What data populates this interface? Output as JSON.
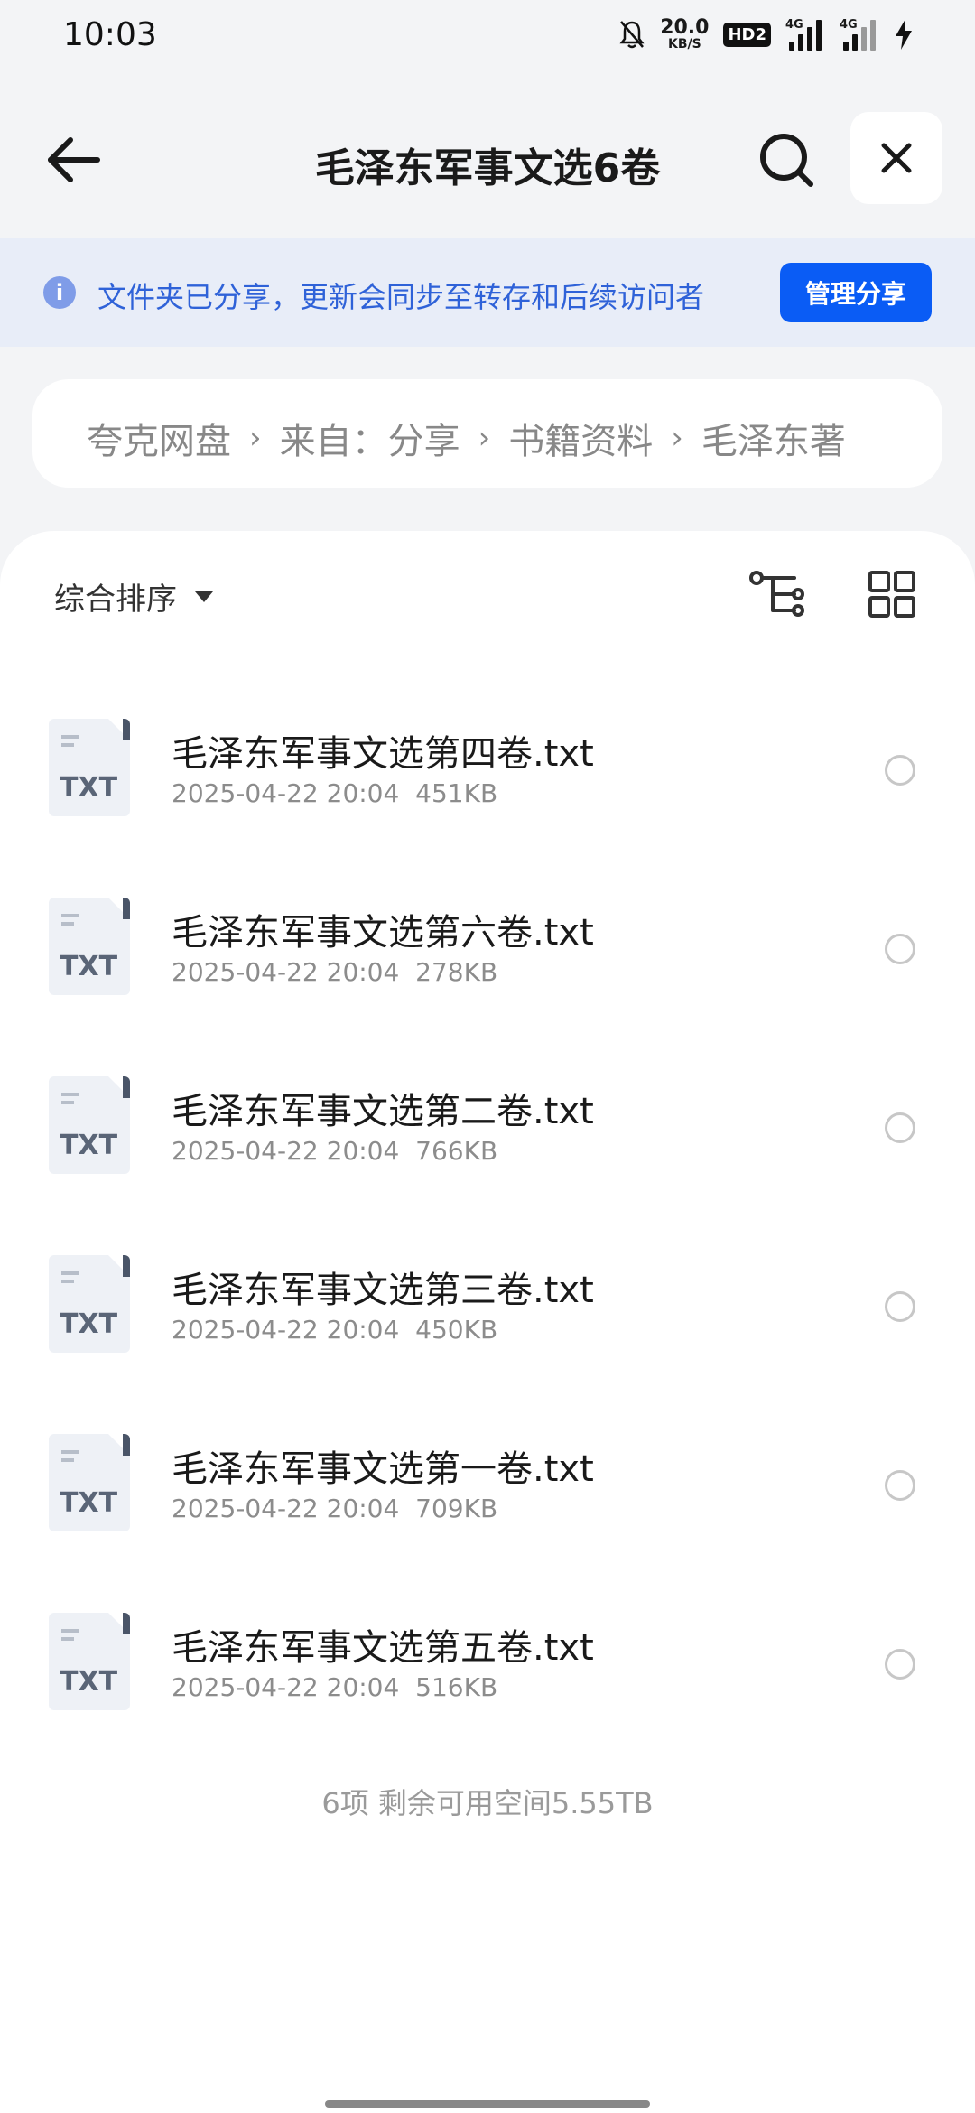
{
  "status_bar": {
    "time": "10:03",
    "net_speed_value": "20.0",
    "net_speed_unit": "KB/S",
    "hd_badge": "HD2",
    "signal_1_label": "4G",
    "signal_2_label": "4G"
  },
  "header": {
    "title": "毛泽东军事文选6卷"
  },
  "share_banner": {
    "text": "文件夹已分享，更新会同步至转存和后续访问者",
    "manage_label": "管理分享",
    "accent": "#0a5cf5"
  },
  "breadcrumb": {
    "items": [
      "夸克网盘",
      "来自：分享",
      "书籍资料",
      "毛泽东著"
    ]
  },
  "toolbar": {
    "sort_label": "综合排序"
  },
  "files": [
    {
      "name": "毛泽东军事文选第四卷.txt",
      "date": "2025-04-22 20:04",
      "size": "451KB",
      "type": "TXT"
    },
    {
      "name": "毛泽东军事文选第六卷.txt",
      "date": "2025-04-22 20:04",
      "size": "278KB",
      "type": "TXT"
    },
    {
      "name": "毛泽东军事文选第二卷.txt",
      "date": "2025-04-22 20:04",
      "size": "766KB",
      "type": "TXT"
    },
    {
      "name": "毛泽东军事文选第三卷.txt",
      "date": "2025-04-22 20:04",
      "size": "450KB",
      "type": "TXT"
    },
    {
      "name": "毛泽东军事文选第一卷.txt",
      "date": "2025-04-22 20:04",
      "size": "709KB",
      "type": "TXT"
    },
    {
      "name": "毛泽东军事文选第五卷.txt",
      "date": "2025-04-22 20:04",
      "size": "516KB",
      "type": "TXT"
    }
  ],
  "footer": {
    "summary": "6项 剩余可用空间5.55TB"
  }
}
